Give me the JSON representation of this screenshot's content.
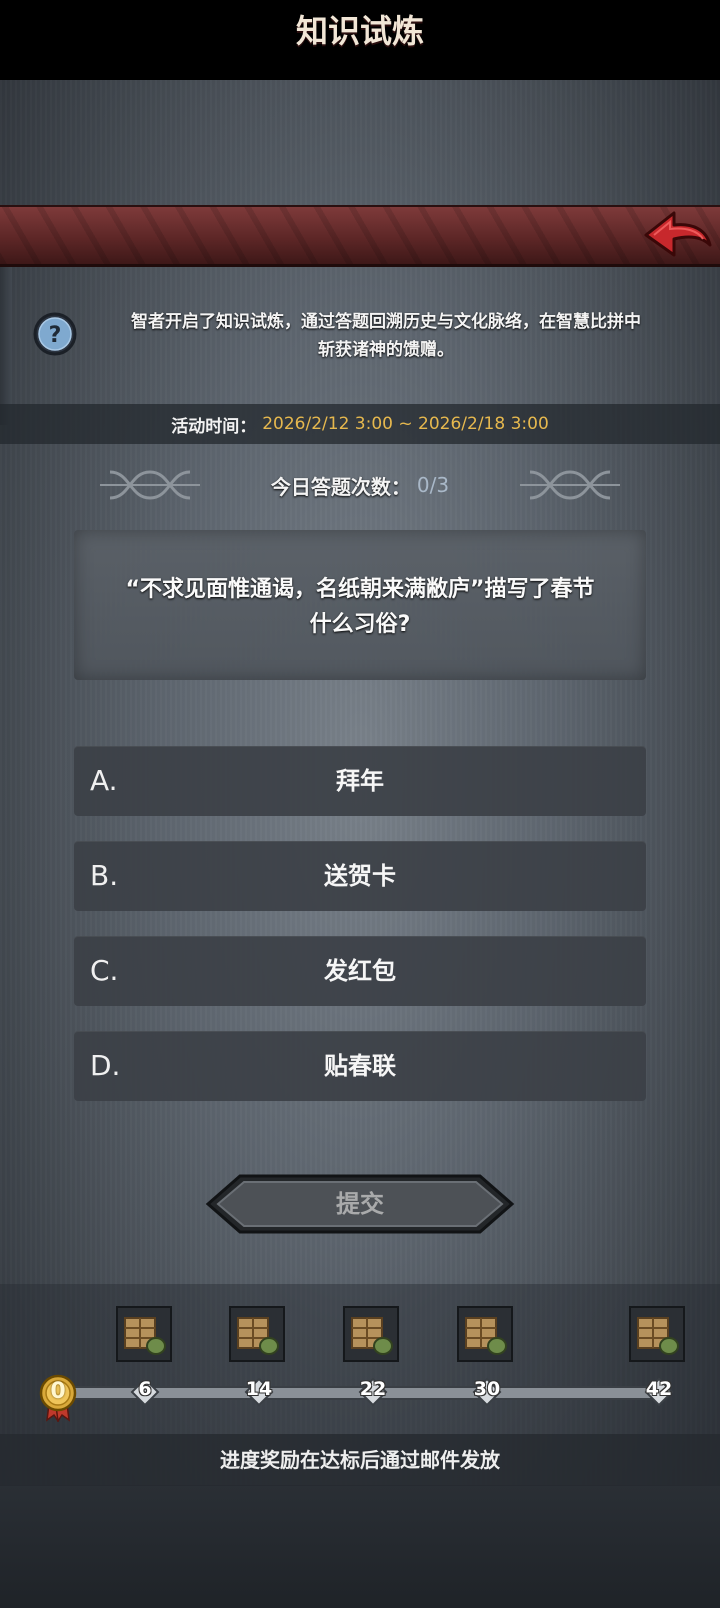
{
  "header": {
    "title": "知识试炼"
  },
  "intro": {
    "text_line1": "智者开启了知识试炼，通过答题回溯历史与文化脉络，在智慧比拼中",
    "text_line2": "斩获诸神的馈赠。"
  },
  "event_time": {
    "label": "活动时间：",
    "value": "2026/2/12 3:00 ~ 2026/2/18 3:00"
  },
  "daily_count": {
    "label": "今日答题次数：",
    "value": "0/3"
  },
  "question": {
    "line1": "“不求见面惟通谒，名纸朝来满敝庐”描写了春节",
    "line2": "什么习俗?"
  },
  "options": [
    {
      "letter": "A.",
      "text": "拜年"
    },
    {
      "letter": "B.",
      "text": "送贺卡"
    },
    {
      "letter": "C.",
      "text": "发红包"
    },
    {
      "letter": "D.",
      "text": "贴春联"
    }
  ],
  "submit": {
    "label": "提交"
  },
  "progress": {
    "current": "0",
    "milestones": [
      "6",
      "14",
      "22",
      "30",
      "42"
    ],
    "footer": "进度奖励在达标后通过邮件发放"
  },
  "colors": {
    "accent_gold": "#e6b84e",
    "banner_red": "#6a2c2c",
    "back_arrow": "#c0262b"
  },
  "icons": {
    "back": "red-back-arrow-icon",
    "help": "question-mark-icon",
    "reward": "treasure-chest-icon"
  }
}
